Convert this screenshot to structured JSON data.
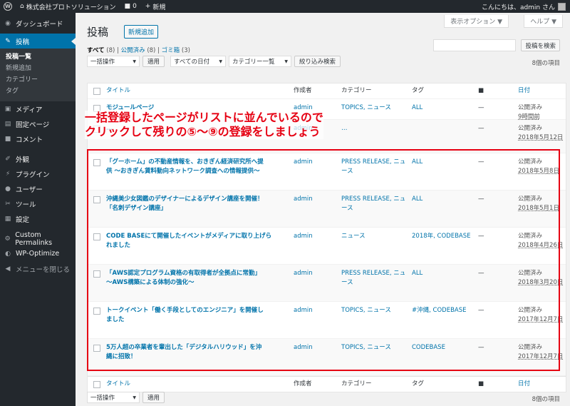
{
  "adminbar": {
    "site_name": "株式会社プロトソリューション",
    "comments_count": "0",
    "new_label": "新規",
    "greeting": "こんにちは、admin さん"
  },
  "sidebar": {
    "items": [
      {
        "label": "ダッシュボード",
        "icon": "dashboard-icon"
      },
      {
        "label": "投稿",
        "icon": "pin-icon"
      },
      {
        "label": "メディア",
        "icon": "media-icon"
      },
      {
        "label": "固定ページ",
        "icon": "page-icon"
      },
      {
        "label": "コメント",
        "icon": "comment-icon"
      },
      {
        "label": "外観",
        "icon": "appearance-icon"
      },
      {
        "label": "プラグイン",
        "icon": "plugin-icon"
      },
      {
        "label": "ユーザー",
        "icon": "user-icon"
      },
      {
        "label": "ツール",
        "icon": "tool-icon"
      },
      {
        "label": "設定",
        "icon": "settings-icon"
      },
      {
        "label": "Custom Permalinks",
        "icon": "gear-icon"
      },
      {
        "label": "WP-Optimize",
        "icon": "optimize-icon"
      },
      {
        "label": "メニューを閉じる",
        "icon": "collapse-icon"
      }
    ],
    "submenu": [
      "投稿一覧",
      "新規追加",
      "カテゴリー",
      "タグ"
    ]
  },
  "header": {
    "screen_options": "表示オプション ▼",
    "help": "ヘルプ ▼",
    "title": "投稿",
    "add_new": "新規追加"
  },
  "filters": {
    "all": "すべて",
    "all_count": "(8)",
    "published": "公開済み",
    "published_count": "(8)",
    "trash": "ゴミ箱",
    "trash_count": "(3)",
    "search_button": "投稿を検索",
    "bulk_action": "一括操作",
    "apply": "適用",
    "all_dates": "すべての日付",
    "category_list": "カテゴリー一覧",
    "filter_button": "絞り込み検索",
    "items_count": "8個の項目"
  },
  "columns": {
    "title": "タイトル",
    "author": "作成者",
    "categories": "カテゴリー",
    "tags": "タグ",
    "date": "日付"
  },
  "rows": [
    {
      "title": [
        "モジュールページ"
      ],
      "author": "admin",
      "cats": [
        "TOPICS, ニュース"
      ],
      "tags": "ALL",
      "comments": "—",
      "status": "公開済み",
      "date": "9時間前"
    },
    {
      "title": [
        "…"
      ],
      "author": "admin",
      "cats": [
        "…"
      ],
      "tags": "",
      "comments": "—",
      "status": "公開済み",
      "date": "2018年5月12日"
    },
    {
      "title": [
        "「グーホーム」の不動産情報を、おきぎん経済研究所へ提",
        "供 ～おきぎん賃料動向ネットワーク調査への情報提供～"
      ],
      "author": "admin",
      "cats": [
        "PRESS RELEASE, ニュ",
        "ース"
      ],
      "tags": "ALL",
      "comments": "—",
      "status": "公開済み",
      "date": "2018年5月8日"
    },
    {
      "title": [
        "沖縄美少女図鑑のデザイナーによるデザイン講座を開催！",
        "「名刺デザイン講座」"
      ],
      "author": "admin",
      "cats": [
        "PRESS RELEASE, ニュ",
        "ース"
      ],
      "tags": "ALL",
      "comments": "—",
      "status": "公開済み",
      "date": "2018年5月1日"
    },
    {
      "title": [
        "CODE BASEにて開催したイベントがメディアに取り上げら",
        "れました"
      ],
      "author": "admin",
      "cats": [
        "ニュース"
      ],
      "tags": "2018年, CODEBASE",
      "comments": "—",
      "status": "公開済み",
      "date": "2018年4月26日"
    },
    {
      "title": [
        "「AWS認定プログラム資格の有取得者が全拠点に常勤」",
        "～AWS構築による体制の強化～"
      ],
      "author": "admin",
      "cats": [
        "PRESS RELEASE, ニュ",
        "ース"
      ],
      "tags": "ALL",
      "comments": "—",
      "status": "公開済み",
      "date": "2018年3月20日"
    },
    {
      "title": [
        "トークイベント「働く手段としてのエンジニア」を開催し",
        "ました"
      ],
      "author": "admin",
      "cats": [
        "TOPICS, ニュース"
      ],
      "tags": "#沖縄, CODEBASE",
      "comments": "—",
      "status": "公開済み",
      "date": "2017年12月7日"
    },
    {
      "title": [
        "5万人超の卒業者を輩出した「デジタルハリウッド」を沖",
        "縄に招致！"
      ],
      "author": "admin",
      "cats": [
        "TOPICS, ニュース"
      ],
      "tags": "CODEBASE",
      "comments": "—",
      "status": "公開済み",
      "date": "2017年12月7日"
    }
  ],
  "annotation": {
    "line1": "一括登録したページがリストに並んでいるので",
    "line2": "クリックして残りの⑤～⑨の登録をしましょう"
  },
  "colors": {
    "accent": "#0073aa",
    "annotation": "#e60012",
    "adminbar": "#23282d"
  }
}
